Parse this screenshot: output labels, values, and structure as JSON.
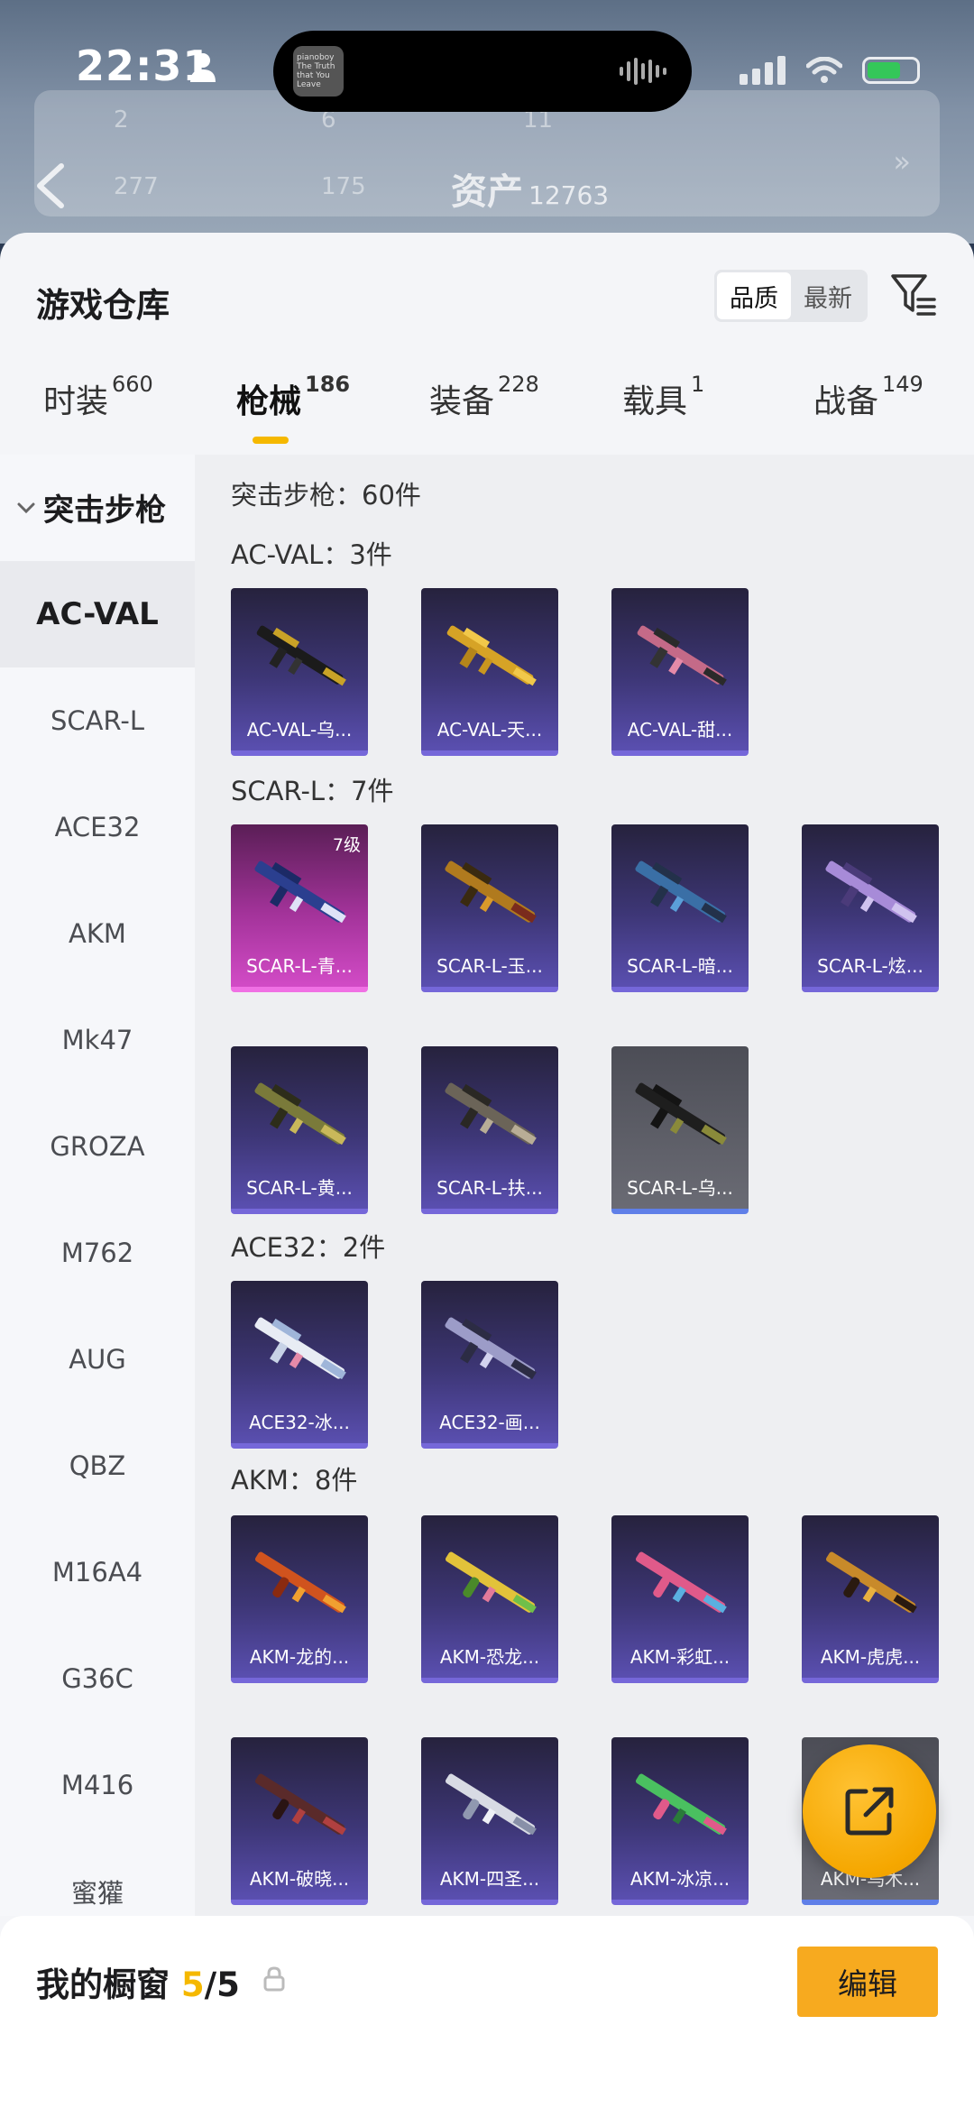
{
  "status_bar": {
    "time": "22:31"
  },
  "island": {
    "thumb_text": "pianoboy The Truth that You Leave"
  },
  "background": {
    "row1_a": "2",
    "row1_b": "6",
    "row1_c": "11",
    "row2_a": "277",
    "row2_b": "175",
    "assets_label": "资产",
    "assets_value": "12763"
  },
  "header": {
    "title": "游戏仓库",
    "sort_options": [
      "品质",
      "最新"
    ]
  },
  "tabs": [
    {
      "label": "时装",
      "count": "660"
    },
    {
      "label": "枪械",
      "count": "186"
    },
    {
      "label": "装备",
      "count": "228"
    },
    {
      "label": "载具",
      "count": "1"
    },
    {
      "label": "战备",
      "count": "149"
    }
  ],
  "sidebar": {
    "header": "突击步枪",
    "items": [
      "AC-VAL",
      "SCAR-L",
      "ACE32",
      "AKM",
      "Mk47",
      "GROZA",
      "M762",
      "AUG",
      "QBZ",
      "M16A4",
      "G36C",
      "M416",
      "蜜獾"
    ]
  },
  "content": {
    "summary": "突击步枪：60件",
    "sections": [
      {
        "label": "AC-VAL：3件",
        "cards": [
          "AC-VAL-乌...",
          "AC-VAL-天...",
          "AC-VAL-甜..."
        ]
      },
      {
        "label": "SCAR-L：7件",
        "cards": [
          "SCAR-L-青...",
          "SCAR-L-玉...",
          "SCAR-L-暗...",
          "SCAR-L-炫...",
          "SCAR-L-黄...",
          "SCAR-L-扶...",
          "SCAR-L-乌..."
        ],
        "badge": "7级"
      },
      {
        "label": "ACE32：2件",
        "cards": [
          "ACE32-冰...",
          "ACE32-画..."
        ]
      },
      {
        "label": "AKM：8件",
        "cards": [
          "AKM-龙的...",
          "AKM-恐龙...",
          "AKM-彩虹...",
          "AKM-虎虎...",
          "AKM-破晓...",
          "AKM-四圣...",
          "AKM-冰凉...",
          "AKM-乌木..."
        ]
      }
    ]
  },
  "bottom_bar": {
    "label": "我的橱窗",
    "count": "5",
    "total": "/5",
    "edit_label": "编辑"
  },
  "colors": {
    "accent": "#f5b800",
    "edit_button": "#f7aa1f",
    "card_purple": "#3d3676",
    "card_pink": "#a3339a"
  }
}
